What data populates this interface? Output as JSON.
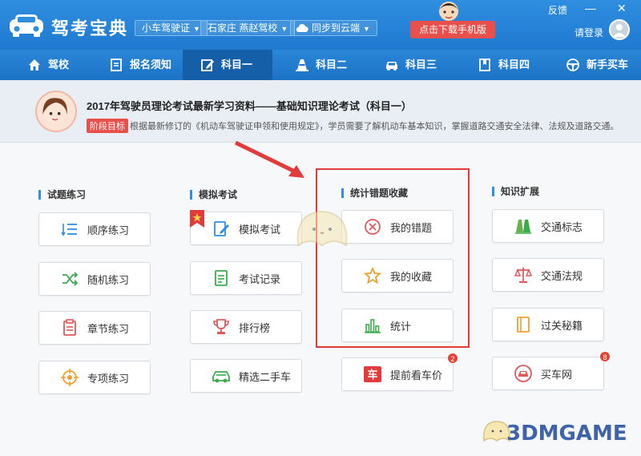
{
  "app": {
    "title": "驾考宝典",
    "logo_icon": "car-logo-icon"
  },
  "header": {
    "license_select": "小车驾驶证",
    "school_select": "石家庄 燕赵驾校",
    "cloud_sync": "同步到云端",
    "download_button": "点击下载手机版",
    "feedback": "反馈",
    "minimize": "—",
    "close": "✕",
    "login": "请登录"
  },
  "nav": {
    "items": [
      {
        "label": "驾校",
        "icon": "home-icon"
      },
      {
        "label": "报名须知",
        "icon": "document-icon"
      },
      {
        "label": "科目一",
        "icon": "edit-icon",
        "active": true
      },
      {
        "label": "科目二",
        "icon": "cone-icon"
      },
      {
        "label": "科目三",
        "icon": "car-icon"
      },
      {
        "label": "科目四",
        "icon": "book-icon"
      },
      {
        "label": "新手买车",
        "icon": "steering-wheel-icon"
      }
    ]
  },
  "banner": {
    "title": "2017年驾驶员理论考试最新学习资料——基础知识理论考试（科目一）",
    "badge": "阶段目标",
    "desc": "根据最新修订的《机动车驾驶证申领和使用规定》，学员需要了解机动车基本知识，掌握道路交通安全法律、法规及道路交通。"
  },
  "sections": {
    "practice": {
      "title": "试题练习",
      "items": [
        "顺序练习",
        "随机练习",
        "章节练习",
        "专项练习"
      ]
    },
    "mock": {
      "title": "模拟考试",
      "items": [
        "模拟考试",
        "考试记录",
        "排行榜",
        "精选二手车"
      ]
    },
    "stats": {
      "title": "统计错题收藏",
      "items": [
        "我的错题",
        "我的收藏",
        "统计",
        "提前看车价"
      ],
      "price_badge": "2"
    },
    "knowledge": {
      "title": "知识扩展",
      "items": [
        "交通标志",
        "交通法规",
        "过关秘籍",
        "买车网"
      ],
      "buy_badge": "8"
    }
  },
  "watermark": "3DMGAME",
  "colors": {
    "primary": "#2f8ee0",
    "nav_active": "#155fa8",
    "accent_red": "#e8504b",
    "highlight_border": "#e23b3b"
  }
}
